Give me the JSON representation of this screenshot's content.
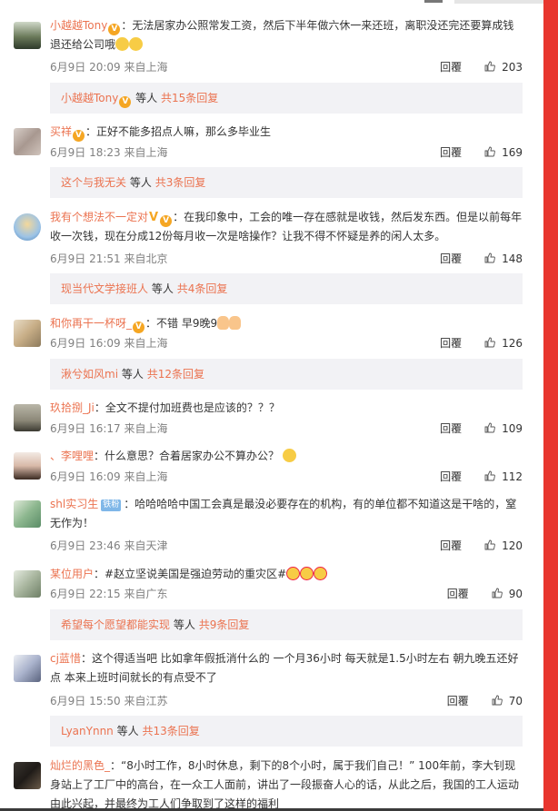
{
  "actions": {
    "reply_label": "回覆"
  },
  "comments": [
    {
      "user": "小越越Tony",
      "text": "：无法居家办公照常发工资，然后下半年做六休一来还班，离职没还完还要算成钱退还给公司哦",
      "time": "6月9日 20:09 来自上海",
      "likes": "203",
      "replies": {
        "user": "小越越Tony",
        "others": "等人",
        "count": "共15条回复"
      }
    },
    {
      "user": "买祥",
      "text": "：正好不能多招点人嘛，那么多毕业生",
      "time": "6月9日 18:23 来自上海",
      "likes": "169",
      "replies": {
        "user": "这个与我无关",
        "others": "等人",
        "count": "共3条回复"
      }
    },
    {
      "user": "我有个想法不一定对",
      "text": "：在我印象中，工会的唯一存在感就是收钱，然后发东西。但是以前每年收一次钱，现在分成12份每月收一次是啥操作？让我不得不怀疑是养的闲人太多。",
      "time": "6月9日 21:51 来自北京",
      "likes": "148",
      "replies": {
        "user": "现当代文学接班人",
        "others": "等人",
        "count": "共4条回复"
      }
    },
    {
      "user": "和你再干一杯呀_",
      "text": "：不错 早9晚9",
      "time": "6月9日 16:09 来自上海",
      "likes": "126",
      "replies": {
        "user": "湫兮如风mi",
        "others": "等人",
        "count": "共12条回复"
      }
    },
    {
      "user": "玖拾捌_Ji",
      "text": "：全文不提付加班费也是应该的？？？",
      "time": "6月9日 16:17 来自上海",
      "likes": "109"
    },
    {
      "user": "、李哩哩",
      "text": "：什么意思？合着居家办公不算办公？",
      "time": "6月9日 16:09 来自上海",
      "likes": "112"
    },
    {
      "user": "shl实习生",
      "badge": "铁粉",
      "text": "：哈哈哈哈中国工会真是最没必要存在的机构，有的单位都不知道这是干啥的，窒无作为！",
      "time": "6月9日 23:46 来自天津",
      "likes": "120"
    },
    {
      "user": "某位用户",
      "text": "：#赵立坚说美国是强迫劳动的重灾区#",
      "time": "6月9日 22:15 来自广东",
      "likes": "90",
      "replies": {
        "user": "希望每个愿望都能实现",
        "others": "等人",
        "count": "共9条回复"
      }
    },
    {
      "user": "cj蓝惜",
      "text": "：这个得适当吧 比如拿年假抵消什么的 一个月36小时 每天就是1.5小时左右 朝九晚五还好点 本来上班时间就长的有点受不了",
      "time": "6月9日 15:50 来自江苏",
      "likes": "70",
      "replies": {
        "user": "LyanYnnn",
        "others": "等人",
        "count": "共13条回复"
      }
    },
    {
      "user": "灿烂的黑色_",
      "text": "：“8小时工作，8小时休息，剩下的8个小时，属于我们自己！” 100年前，李大钊现身站上了工厂中的高台，在一众工人面前，讲出了一段振奋人心的话，从此之后，我国的工人运动由此兴起，并最终为工人们争取到了这样的福利"
    }
  ],
  "colors": {
    "username": "#eb7350",
    "reply_bg": "#f2f2f5",
    "scrollbar": "#e8362e"
  }
}
